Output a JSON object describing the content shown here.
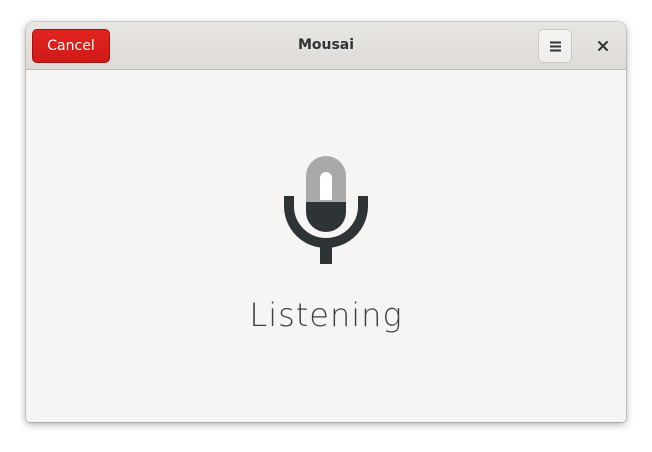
{
  "window": {
    "title": "Mousai"
  },
  "headerbar": {
    "cancel_label": "Cancel",
    "menu_icon": "hamburger-menu-icon",
    "close_icon": "close-icon"
  },
  "main": {
    "status_icon": "microphone-icon",
    "status_text": "Listening"
  },
  "colors": {
    "destructive_accent": "#d81d1a",
    "window_background": "#f6f5f4",
    "headerbar_background": "#e2dfdb",
    "icon_dark": "#2e3436",
    "icon_light": "#a9a9a9"
  }
}
